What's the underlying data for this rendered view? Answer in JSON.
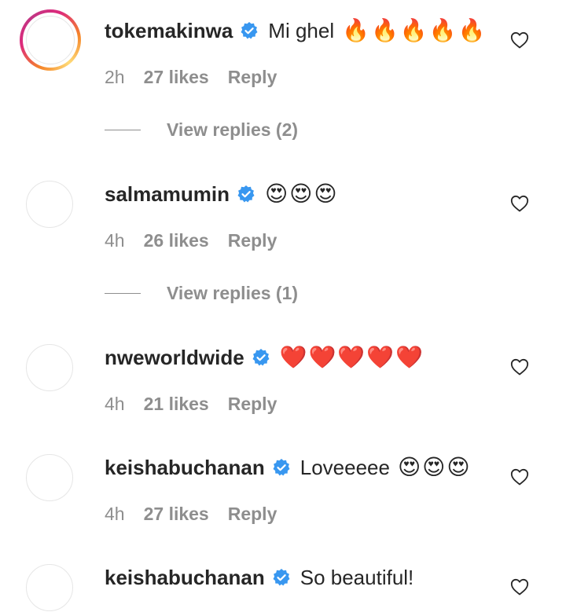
{
  "comments": [
    {
      "username": "tokemakinwa",
      "text": "Mi ghel",
      "emoji": "🔥🔥🔥🔥🔥",
      "time": "2h",
      "likes": "27 likes",
      "reply": "Reply",
      "view_replies": "View replies (2)",
      "has_story_ring": true
    },
    {
      "username": "salmamumin",
      "text": "",
      "emoji": "😍😍😍",
      "time": "4h",
      "likes": "26 likes",
      "reply": "Reply",
      "view_replies": "View replies (1)",
      "has_story_ring": false
    },
    {
      "username": "nweworldwide",
      "text": "",
      "emoji": "❤️❤️❤️❤️❤️",
      "time": "4h",
      "likes": "21 likes",
      "reply": "Reply",
      "view_replies": "",
      "has_story_ring": false
    },
    {
      "username": "keishabuchanan",
      "text": "Loveeeee",
      "emoji": "😍😍😍",
      "time": "4h",
      "likes": "27 likes",
      "reply": "Reply",
      "view_replies": "",
      "has_story_ring": false
    },
    {
      "username": "keishabuchanan",
      "text": "So beautiful!",
      "emoji": "",
      "time": "",
      "likes": "",
      "reply": "",
      "view_replies": "",
      "has_story_ring": false
    }
  ],
  "colors": {
    "verified_badge": "#3897f0",
    "secondary_text": "#8e8e8e",
    "primary_text": "#262626",
    "heart_emoji": "#e0161e"
  },
  "icons": {
    "verified": "verified-badge-icon",
    "like": "heart-outline-icon"
  }
}
